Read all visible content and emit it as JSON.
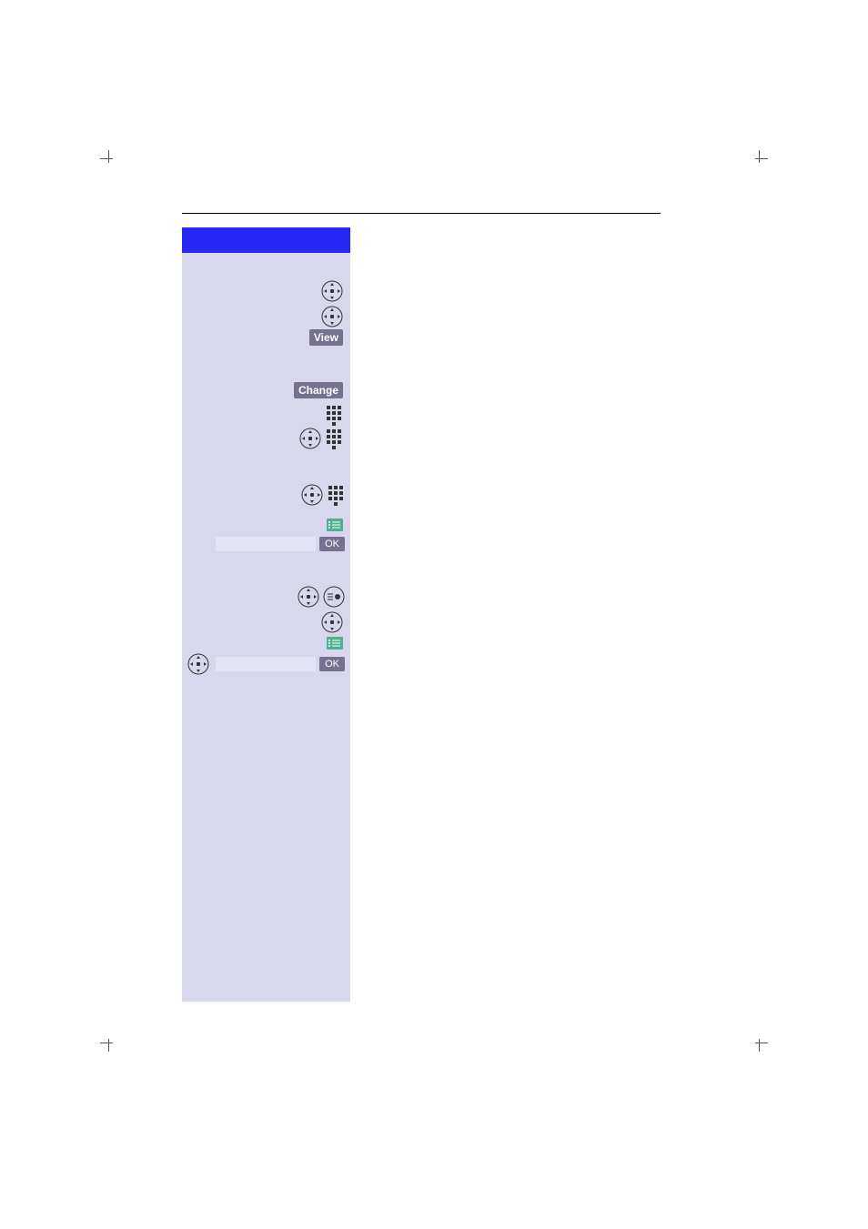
{
  "labels": {
    "view": "View",
    "change": "Change",
    "ok": "OK"
  }
}
